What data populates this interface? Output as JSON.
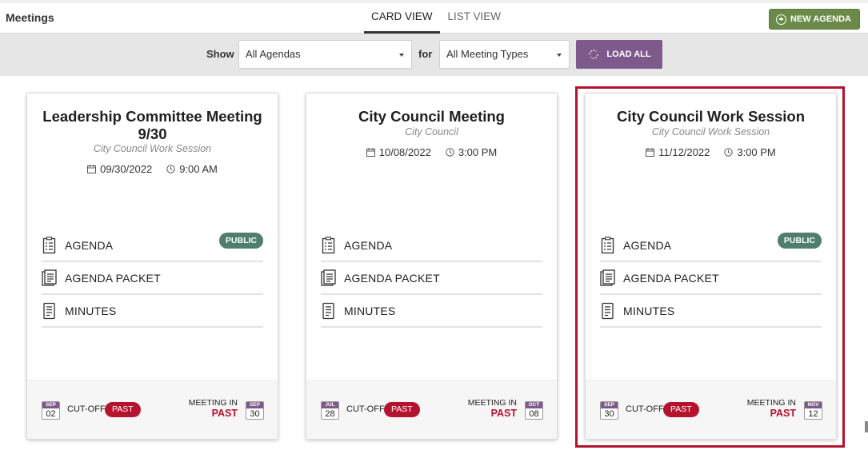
{
  "header": {
    "title": "Meetings",
    "tabs": [
      {
        "label": "CARD VIEW",
        "active": true
      },
      {
        "label": "LIST VIEW",
        "active": false
      }
    ],
    "new_agenda_label": "NEW AGENDA"
  },
  "filters": {
    "show_label": "Show",
    "agenda_select": "All Agendas",
    "for_label": "for",
    "type_select": "All Meeting Types",
    "load_all_label": "LOAD ALL"
  },
  "colors": {
    "accent_purple": "#7e5a8c",
    "new_button_green": "#6b8a4a",
    "public_badge": "#4f7d6e",
    "past_red": "#b5122e"
  },
  "cards": [
    {
      "title": "Leadership Committee Meeting 9/30",
      "subtitle": "City Council Work Session",
      "date": "09/30/2022",
      "time": "9:00 AM",
      "docs": [
        {
          "label": "AGENDA",
          "badge": "PUBLIC"
        },
        {
          "label": "AGENDA PACKET",
          "badge": ""
        },
        {
          "label": "MINUTES",
          "badge": ""
        }
      ],
      "cutoff": {
        "month": "SEP",
        "day": "02",
        "label": "CUT-OFF",
        "status": "PAST"
      },
      "meeting_in": {
        "label": "MEETING IN",
        "status": "PAST",
        "month": "SEP",
        "day": "30"
      }
    },
    {
      "title": "City Council Meeting",
      "subtitle": "City Council",
      "date": "10/08/2022",
      "time": "3:00 PM",
      "docs": [
        {
          "label": "AGENDA",
          "badge": ""
        },
        {
          "label": "AGENDA PACKET",
          "badge": ""
        },
        {
          "label": "MINUTES",
          "badge": ""
        }
      ],
      "cutoff": {
        "month": "JUL",
        "day": "28",
        "label": "CUT-OFF",
        "status": "PAST"
      },
      "meeting_in": {
        "label": "MEETING IN",
        "status": "PAST",
        "month": "OCT",
        "day": "08"
      }
    },
    {
      "title": "City Council Work Session",
      "subtitle": "City Council Work Session",
      "date": "11/12/2022",
      "time": "3:00 PM",
      "docs": [
        {
          "label": "AGENDA",
          "badge": "PUBLIC"
        },
        {
          "label": "AGENDA PACKET",
          "badge": ""
        },
        {
          "label": "MINUTES",
          "badge": ""
        }
      ],
      "cutoff": {
        "month": "SEP",
        "day": "30",
        "label": "CUT-OFF",
        "status": "PAST"
      },
      "meeting_in": {
        "label": "MEETING IN",
        "status": "PAST",
        "month": "NOV",
        "day": "12"
      }
    }
  ]
}
